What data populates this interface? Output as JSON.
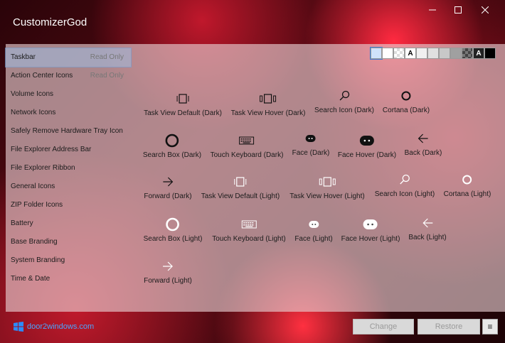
{
  "app": {
    "title": "CustomizerGod"
  },
  "sidebar": {
    "items": [
      {
        "label": "Taskbar",
        "note": "Read Only",
        "selected": true
      },
      {
        "label": "Action Center Icons",
        "note": "Read Only"
      },
      {
        "label": "Volume Icons"
      },
      {
        "label": "Network Icons"
      },
      {
        "label": "Safely Remove Hardware Tray Icon"
      },
      {
        "label": "File Explorer Address Bar"
      },
      {
        "label": "File Explorer Ribbon"
      },
      {
        "label": "General Icons"
      },
      {
        "label": "ZIP Folder Icons"
      },
      {
        "label": "Battery"
      },
      {
        "label": "Base Branding"
      },
      {
        "label": "System Branding"
      },
      {
        "label": "Time & Date"
      }
    ]
  },
  "swatches": [
    "#cfe2fb",
    "#ffffff",
    "checker",
    "A",
    "#f0f0f0",
    "#e0e0e0",
    "#c8c8c8",
    "#a0a0a0",
    "checker-dark",
    "A-dark",
    "#000000"
  ],
  "icons": [
    {
      "label": "Task View Default (Dark)",
      "icon": "task-view-icon",
      "theme": "dark"
    },
    {
      "label": "Task View Hover (Dark)",
      "icon": "task-view-hover-icon",
      "theme": "dark"
    },
    {
      "label": "Search Icon (Dark)",
      "icon": "search-icon",
      "theme": "dark"
    },
    {
      "label": "Cortana (Dark)",
      "icon": "cortana-icon",
      "theme": "dark"
    },
    {
      "label": "Search Box (Dark)",
      "icon": "search-box-icon",
      "theme": "dark"
    },
    {
      "label": "Touch Keyboard (Dark)",
      "icon": "keyboard-icon",
      "theme": "dark"
    },
    {
      "label": "Face (Dark)",
      "icon": "face-icon",
      "theme": "dark"
    },
    {
      "label": "Face Hover (Dark)",
      "icon": "face-hover-icon",
      "theme": "dark"
    },
    {
      "label": "Back (Dark)",
      "icon": "back-arrow-icon",
      "theme": "dark"
    },
    {
      "label": "Forward (Dark)",
      "icon": "forward-arrow-icon",
      "theme": "dark"
    },
    {
      "label": "Task View Default (Light)",
      "icon": "task-view-icon",
      "theme": "light"
    },
    {
      "label": "Task View Hover (Light)",
      "icon": "task-view-hover-icon",
      "theme": "light"
    },
    {
      "label": "Search Icon (Light)",
      "icon": "search-icon",
      "theme": "light"
    },
    {
      "label": "Cortana (Light)",
      "icon": "cortana-icon",
      "theme": "light"
    },
    {
      "label": "Search Box (Light)",
      "icon": "search-box-icon",
      "theme": "light"
    },
    {
      "label": "Touch Keyboard (Light)",
      "icon": "keyboard-icon",
      "theme": "light"
    },
    {
      "label": "Face (Light)",
      "icon": "face-icon",
      "theme": "light"
    },
    {
      "label": "Face Hover (Light)",
      "icon": "face-hover-icon",
      "theme": "light"
    },
    {
      "label": "Back (Light)",
      "icon": "back-arrow-icon",
      "theme": "light"
    },
    {
      "label": "Forward (Light)",
      "icon": "forward-arrow-icon",
      "theme": "light"
    }
  ],
  "footer": {
    "brand": "door2windows.com",
    "change_label": "Change",
    "restore_label": "Restore",
    "menu_label": "≡"
  },
  "colors": {
    "accent": "#3b7bd1",
    "brand_text": "#4aa3ff",
    "dark_icon": "#111111",
    "light_icon": "#ffffff"
  }
}
